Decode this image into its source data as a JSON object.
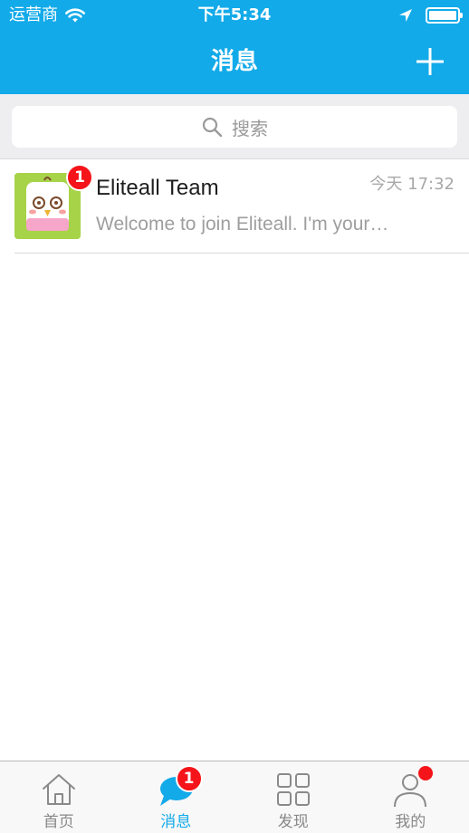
{
  "status_bar": {
    "carrier": "运营商",
    "time": "下午5:34"
  },
  "nav": {
    "title": "消息",
    "add_icon": "plus-icon"
  },
  "search": {
    "placeholder": "搜索",
    "icon": "search-icon"
  },
  "conversations": [
    {
      "name": "Eliteall Team",
      "time": "今天 17:32",
      "preview": "Welcome to join Eliteall. I'm your…",
      "unread": "1",
      "avatar_icon": "cartoon-bird-avatar"
    }
  ],
  "tabs": [
    {
      "label": "首页",
      "icon": "home-icon",
      "active": false
    },
    {
      "label": "消息",
      "icon": "chat-bubble-icon",
      "active": true,
      "badge": "1"
    },
    {
      "label": "发现",
      "icon": "grid-icon",
      "active": false
    },
    {
      "label": "我的",
      "icon": "person-icon",
      "active": false,
      "dot": true
    }
  ],
  "colors": {
    "brand": "#12aae9",
    "badge": "#f5141a",
    "background": "#ffffff"
  }
}
